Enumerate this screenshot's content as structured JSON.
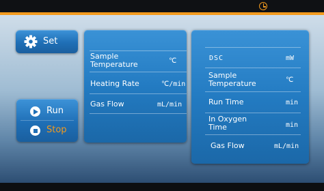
{
  "colors": {
    "accent": "#f29a1e",
    "panel_blue": "#237bc2",
    "stop_text": "#f29a1e"
  },
  "header": {
    "clock_icon": "clock-icon"
  },
  "buttons": {
    "set": {
      "label": "Set",
      "icon": "gear-icon"
    },
    "run": {
      "label": "Run",
      "icon": "play-circle-icon"
    },
    "stop": {
      "label": "Stop",
      "icon": "stop-circle-icon"
    }
  },
  "left_panel": {
    "rows": [
      {
        "label_line1": "Sample",
        "label_line2": "Temperature",
        "unit": "℃"
      },
      {
        "label": "Heating Rate",
        "unit": "℃/min"
      },
      {
        "label": "Gas Flow",
        "unit": "mL/min"
      }
    ]
  },
  "right_panel": {
    "rows": [
      {
        "label": "DSC",
        "unit": "mW"
      },
      {
        "label_line1": "Sample",
        "label_line2": "Temperature",
        "unit": "℃"
      },
      {
        "label": "Run Time",
        "unit": "min"
      },
      {
        "label_line1": "In Oxygen",
        "label_line2": "Time",
        "unit": "min"
      },
      {
        "label": "Gas Flow",
        "unit": "mL/min"
      }
    ]
  }
}
